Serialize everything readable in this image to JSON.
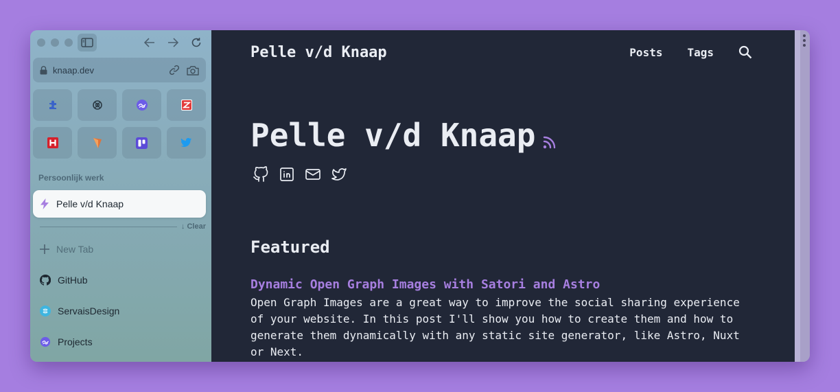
{
  "browser": {
    "url": "knaap.dev",
    "favorites": [
      {
        "icon": "puzzle-icon",
        "color": "#3a63c9"
      },
      {
        "icon": "openai-icon",
        "color": "#2b3a44"
      },
      {
        "icon": "linear-app-icon",
        "color": "#6c5ce7"
      },
      {
        "icon": "z-app-icon",
        "color": "#e23a3a"
      },
      {
        "icon": "h-app-icon",
        "color": "#d5202b"
      },
      {
        "icon": "pin-icon",
        "color": "#e0733a"
      },
      {
        "icon": "trello-icon",
        "color": "#5b4bd8"
      },
      {
        "icon": "twitter-icon",
        "color": "#1d9bf0"
      }
    ],
    "section_label": "Persoonlijk werk",
    "active_tab": {
      "label": "Pelle v/d Knaap",
      "icon": "bolt-icon"
    },
    "clear_label": "↓ Clear",
    "new_tab_label": "New Tab",
    "tabs": [
      {
        "label": "GitHub",
        "icon": "github-icon"
      },
      {
        "label": "ServaisDesign",
        "icon": "servais-icon"
      },
      {
        "label": "Projects",
        "icon": "linear-app-icon"
      }
    ]
  },
  "site": {
    "title": "Pelle v/d Knaap",
    "nav": [
      "Posts",
      "Tags"
    ],
    "hero_title": "Pelle v/d Knaap",
    "featured_heading": "Featured",
    "post": {
      "title": "Dynamic Open Graph Images with Satori and Astro",
      "description": "Open Graph Images are a great way to improve the social sharing experience of your website. In this post I'll show you how to create them and how to generate them dynamically with any static site generator, like Astro, Nuxt or Next."
    },
    "accent_color": "#a77fe0",
    "background_color": "#212737"
  }
}
